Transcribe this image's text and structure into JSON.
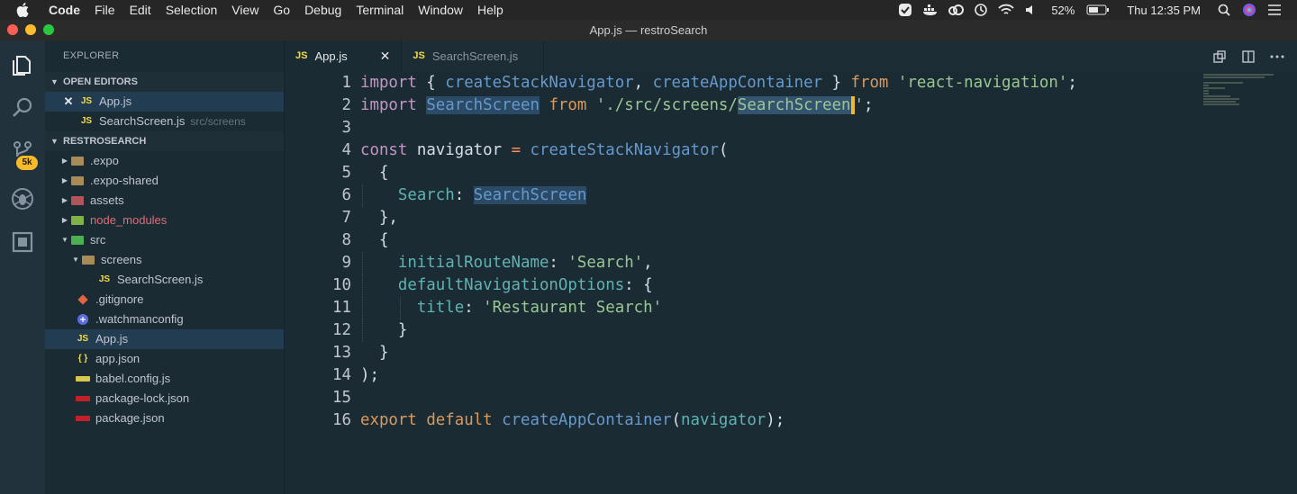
{
  "menubar": {
    "app_name": "Code",
    "items": [
      "File",
      "Edit",
      "Selection",
      "View",
      "Go",
      "Debug",
      "Terminal",
      "Window",
      "Help"
    ],
    "battery": "52%",
    "clock": "Thu 12:35 PM"
  },
  "window": {
    "title": "App.js — restroSearch"
  },
  "activity": {
    "badge": "5k"
  },
  "explorer": {
    "title": "EXPLORER",
    "open_editors_title": "OPEN EDITORS",
    "open_editors": [
      {
        "name": "App.js",
        "desc": ""
      },
      {
        "name": "SearchScreen.js",
        "desc": "src/screens"
      }
    ],
    "project_title": "RESTROSEARCH",
    "tree": [
      {
        "name": ".expo"
      },
      {
        "name": ".expo-shared"
      },
      {
        "name": "assets"
      },
      {
        "name": "node_modules"
      },
      {
        "name": "src"
      },
      {
        "name": "screens"
      },
      {
        "name": "SearchScreen.js"
      },
      {
        "name": ".gitignore"
      },
      {
        "name": ".watchmanconfig"
      },
      {
        "name": "App.js"
      },
      {
        "name": "app.json"
      },
      {
        "name": "babel.config.js"
      },
      {
        "name": "package-lock.json"
      },
      {
        "name": "package.json"
      }
    ]
  },
  "tabs": [
    {
      "label": "App.js",
      "icon": "JS"
    },
    {
      "label": "SearchScreen.js",
      "icon": "JS"
    }
  ],
  "editor": {
    "line_numbers": [
      "1",
      "2",
      "3",
      "4",
      "5",
      "6",
      "7",
      "8",
      "9",
      "10",
      "11",
      "12",
      "13",
      "14",
      "15",
      "16"
    ],
    "tokens": {
      "import": "import",
      "from": "from",
      "const": "const",
      "export": "export",
      "default": "default",
      "createStackNavigator": "createStackNavigator",
      "createAppContainer": "createAppContainer",
      "react_navigation": "'react-navigation'",
      "SearchScreen": "SearchScreen",
      "path_prefix": "'./src/screens/",
      "quote": "'",
      "navigator": "navigator",
      "Search_key": "Search",
      "initialRouteName": "initialRouteName",
      "search_str": "'Search'",
      "defaultNavigationOptions": "defaultNavigationOptions",
      "title": "title",
      "restaurant_search": "'Restaurant Search'"
    }
  }
}
